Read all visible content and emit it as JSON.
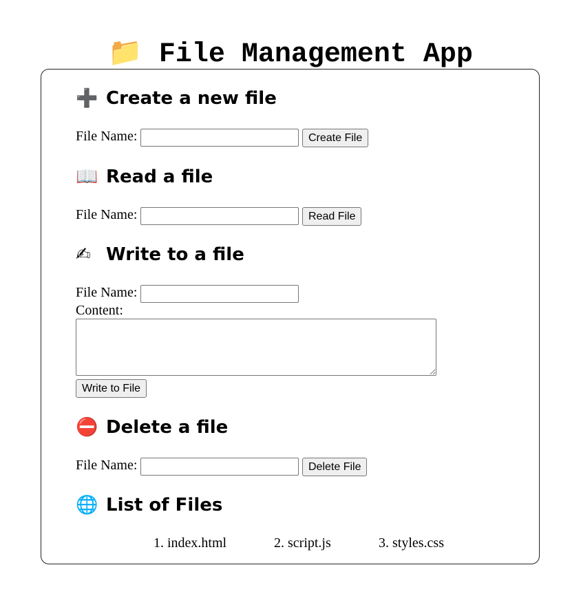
{
  "header": {
    "icon": "folder-icon",
    "emoji": "📁",
    "title": "File Management App"
  },
  "sections": {
    "create": {
      "icon": "plus-icon",
      "emoji": "➕",
      "heading": "Create a new file",
      "file_label": "File Name:",
      "file_value": "",
      "button": "Create File"
    },
    "read": {
      "icon": "open-book-icon",
      "emoji": "📖",
      "heading": "Read a file",
      "file_label": "File Name:",
      "file_value": "",
      "button": "Read File"
    },
    "write": {
      "icon": "writing-hand-icon",
      "emoji": "✍",
      "heading": "Write to a file",
      "file_label": "File Name:",
      "file_value": "",
      "content_label": "Content:",
      "content_value": "",
      "button": "Write to File"
    },
    "delete": {
      "icon": "no-entry-icon",
      "emoji": "⛔",
      "heading": "Delete a file",
      "file_label": "File Name:",
      "file_value": "",
      "button": "Delete File"
    },
    "list": {
      "icon": "globe-icon",
      "emoji": "🌐",
      "heading": "List of Files",
      "files": [
        "1. index.html",
        "2. script.js",
        "3. styles.css"
      ]
    }
  }
}
